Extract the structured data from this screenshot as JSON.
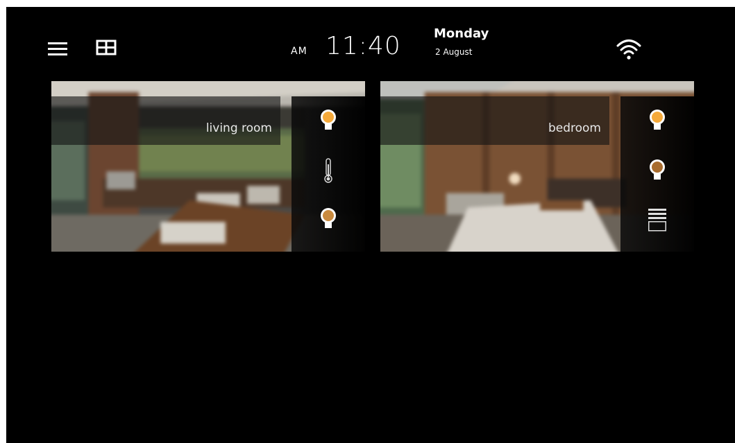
{
  "header": {
    "menu_icon": "hamburger-menu-icon",
    "view_icon": "grid-view-icon",
    "wifi_icon": "wifi-icon",
    "clock": {
      "ampm": "AM",
      "time": "11:40",
      "day": "Monday",
      "date": "2 August"
    }
  },
  "rooms": [
    {
      "label": "living room",
      "controls": [
        {
          "icon": "light-bulb-icon",
          "state": "on",
          "color": "#f5a93a"
        },
        {
          "icon": "thermometer-icon",
          "state": "neutral",
          "color": "#d8d8d8"
        },
        {
          "icon": "light-bulb-icon",
          "state": "dim",
          "color": "#c98a3e"
        }
      ]
    },
    {
      "label": "bedroom",
      "controls": [
        {
          "icon": "light-bulb-icon",
          "state": "on",
          "color": "#f5a93a"
        },
        {
          "icon": "light-bulb-icon",
          "state": "dim",
          "color": "#a86c2e"
        },
        {
          "icon": "window-blinds-icon",
          "state": "neutral",
          "color": "#e0e0e0"
        }
      ]
    }
  ],
  "colors": {
    "background": "#000000",
    "bulb_on": "#f5a93a",
    "bulb_dim": "#b9793a",
    "text": "#ffffff"
  }
}
